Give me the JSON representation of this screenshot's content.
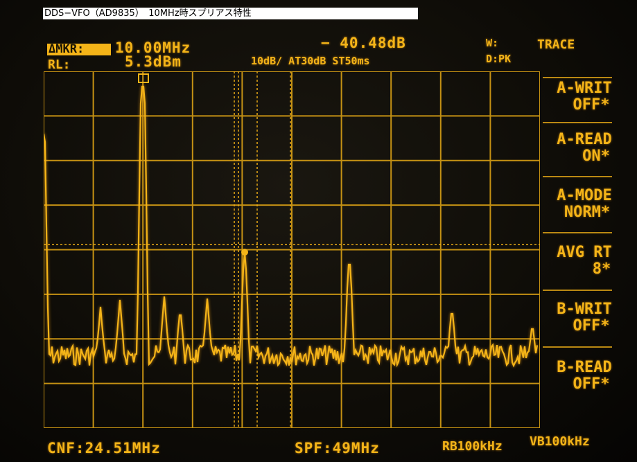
{
  "caption": "DDS−VFO（AD9835）　10MHz時スプリアス特性",
  "header": {
    "marker_label": "ΔMKR:",
    "marker_freq": "10.00MHz",
    "ref_label": "RL:",
    "ref_value": "5.3dBm",
    "marker_level": "− 40.48dB",
    "settings": "10dB/  AT30dB  ST50ms",
    "w_label": "W:",
    "d_label": "D:PK",
    "menu_title": "TRACE"
  },
  "menu": [
    {
      "line1": "A-WRIT",
      "line2": "OFF*"
    },
    {
      "line1": "A-READ",
      "line2": "ON*"
    },
    {
      "line1": "A-MODE",
      "line2": "NORM*"
    },
    {
      "line1": "AVG RT",
      "line2": "8*"
    },
    {
      "line1": "B-WRIT",
      "line2": "OFF*"
    },
    {
      "line1": "B-READ",
      "line2": "OFF*"
    }
  ],
  "footer": {
    "cnf": "CNF:24.51MHz",
    "spf": "SPF:49MHz",
    "rbw": "RB100kHz",
    "vbw": "VB100kHz"
  },
  "colors": {
    "trace": "#f4b418",
    "grid": "#d9a015",
    "background": "#0b0a06"
  }
}
